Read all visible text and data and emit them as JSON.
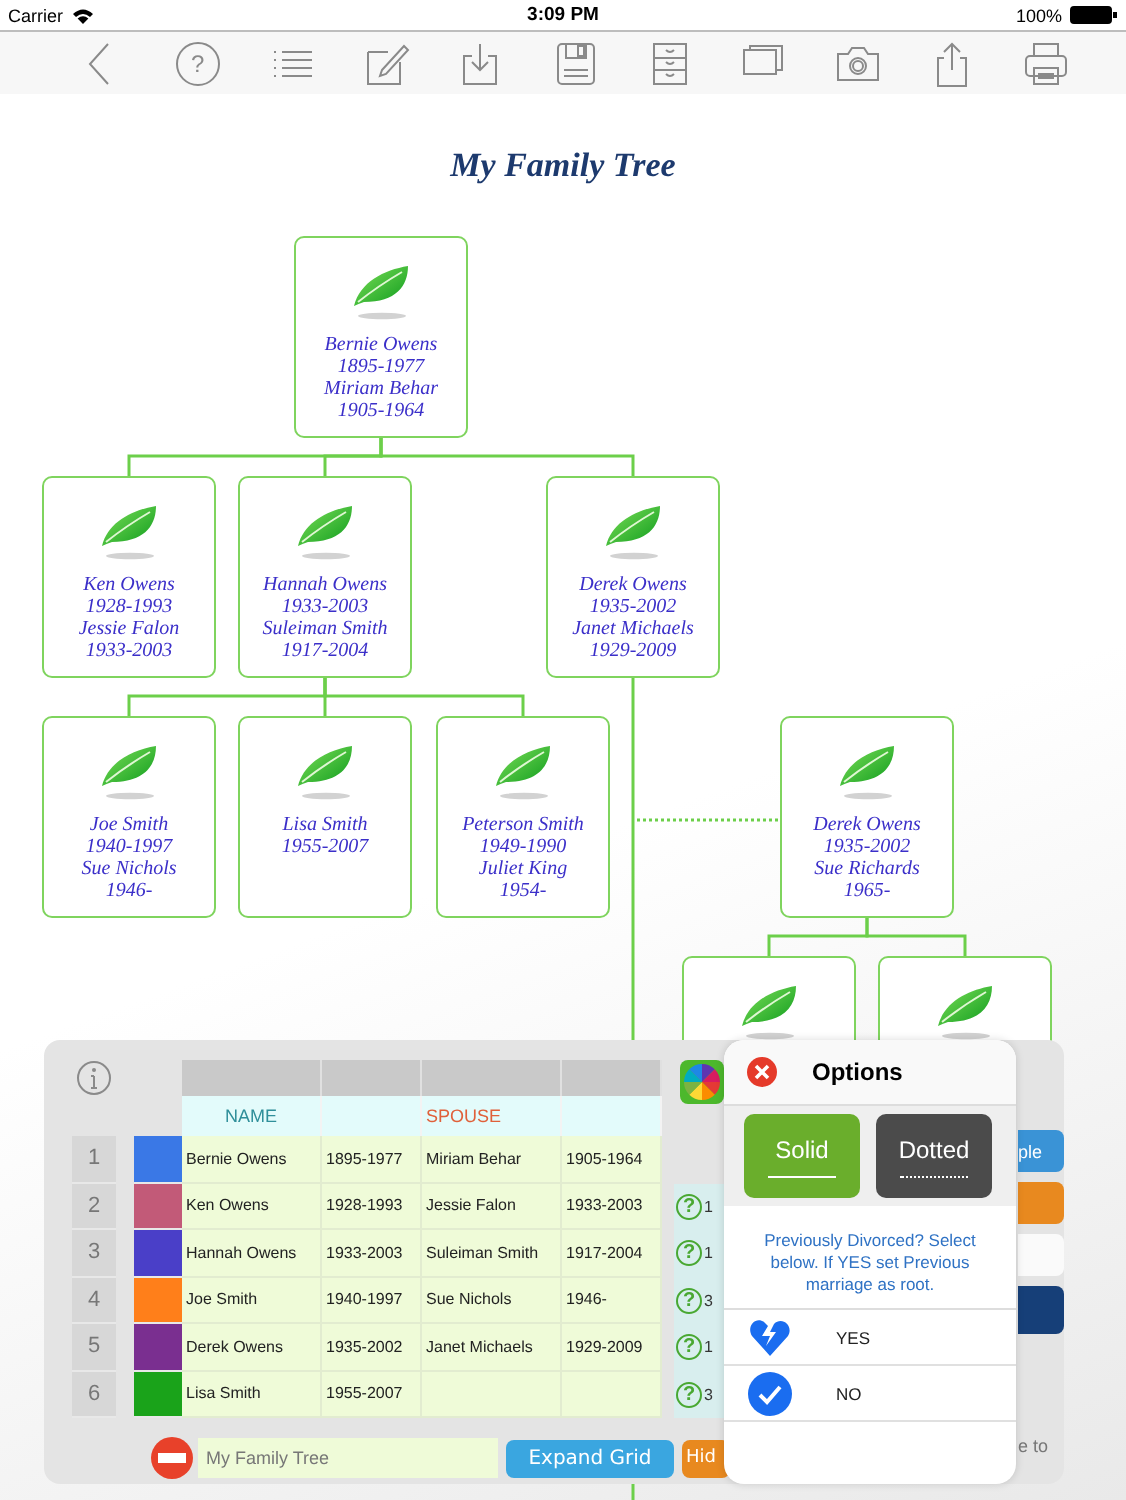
{
  "status_bar": {
    "carrier": "Carrier",
    "time": "3:09 PM",
    "battery": "100%"
  },
  "toolbar": [
    {
      "kind": "back"
    },
    {
      "kind": "help",
      "glyph": "?"
    },
    {
      "kind": "list"
    },
    {
      "kind": "edit"
    },
    {
      "kind": "download"
    },
    {
      "kind": "save"
    },
    {
      "kind": "cabinet"
    },
    {
      "kind": "windows"
    },
    {
      "kind": "camera"
    },
    {
      "kind": "share"
    },
    {
      "kind": "print"
    }
  ],
  "tree": {
    "title": "My Family Tree",
    "root": {
      "lines": [
        "Bernie Owens",
        "1895-1977",
        "Miriam Behar",
        "1905-1964"
      ],
      "children": [
        {
          "lines": [
            "Ken Owens",
            "1928-1993",
            "Jessie Falon",
            "1933-2003"
          ]
        },
        {
          "lines": [
            "Hannah Owens",
            "1933-2003",
            "Suleiman Smith",
            "1917-2004"
          ],
          "children": [
            {
              "lines": [
                "Joe Smith",
                "1940-1997",
                "Sue Nichols",
                "1946-"
              ]
            },
            {
              "lines": [
                "Lisa Smith",
                "1955-2007"
              ]
            },
            {
              "lines": [
                "Peterson Smith",
                "1949-1990",
                "Juliet King",
                "1954-"
              ]
            }
          ]
        },
        {
          "lines": [
            "Derek Owens",
            "1935-2002",
            "Janet Michaels",
            "1929-2009"
          ],
          "children": [
            {
              "dotted_link": true,
              "lines": [
                "Derek Owens",
                "1935-2002",
                "Sue Richards",
                "1965-"
              ],
              "children": [
                {
                  "dotted_link": false
                },
                {
                  "dotted_link": false
                }
              ]
            }
          ]
        }
      ]
    }
  },
  "grid": {
    "headers": [
      {
        "label": "NAME",
        "kind": "name"
      },
      {
        "kind": "blank"
      },
      {
        "label": "SPOUSE",
        "kind": "spouse"
      },
      {
        "kind": "blank"
      }
    ],
    "rows": [
      {
        "number": "1",
        "color": "#3a78e6",
        "name": "Bernie Owens",
        "dates": "1895-1977",
        "spouse": "Miriam Behar",
        "spouse_dates": "1905-1964"
      },
      {
        "number": "2",
        "color": "#c25a78",
        "name": "Ken Owens",
        "dates": "1928-1993",
        "spouse": "Jessie Falon",
        "spouse_dates": "1933-2003",
        "mark": "?",
        "column_9": "1"
      },
      {
        "number": "3",
        "color": "#4a3fc8",
        "name": "Hannah Owens",
        "dates": "1933-2003",
        "spouse": "Suleiman Smith",
        "spouse_dates": "1917-2004",
        "mark": "?",
        "column_9": "1"
      },
      {
        "number": "4",
        "color": "#ff7f1a",
        "name": "Joe Smith",
        "dates": "1940-1997",
        "spouse": "Sue Nichols",
        "spouse_dates": "1946-",
        "mark": "?",
        "column_9": "3"
      },
      {
        "number": "5",
        "color": "#7a2f90",
        "name": "Derek Owens",
        "dates": "1935-2002",
        "spouse": "Janet Michaels",
        "spouse_dates": "1929-2009",
        "mark": "?",
        "column_9": "1"
      },
      {
        "number": "6",
        "color": "#1aa31a",
        "name": "Lisa Smith",
        "dates": "1955-2007",
        "mark": "?",
        "column_9": "3"
      }
    ]
  },
  "bottom_bar": {
    "title_field": {
      "value": "My Family Tree"
    },
    "buttons": [
      {
        "label": "Expand Grid",
        "kind": "expand"
      },
      {
        "label": "Hid",
        "kind": "hide"
      }
    ],
    "hint": "e to"
  },
  "side_buttons": [
    {
      "label": "ple",
      "kind": "blue"
    },
    {
      "kind": "orange"
    },
    {
      "kind": "field"
    },
    {
      "kind": "navy"
    }
  ],
  "options_popover": {
    "title": "Options",
    "line_styles": [
      {
        "label": "Solid",
        "kind": "solid",
        "selected": true
      },
      {
        "label": "Dotted",
        "kind": "dotted",
        "selected": false
      }
    ],
    "message": "Previously Divorced? Select below. If YES set Previous marriage as root.",
    "choices": [
      {
        "label": "YES",
        "kind": "broken-heart"
      },
      {
        "label": "NO",
        "kind": "check"
      }
    ]
  }
}
